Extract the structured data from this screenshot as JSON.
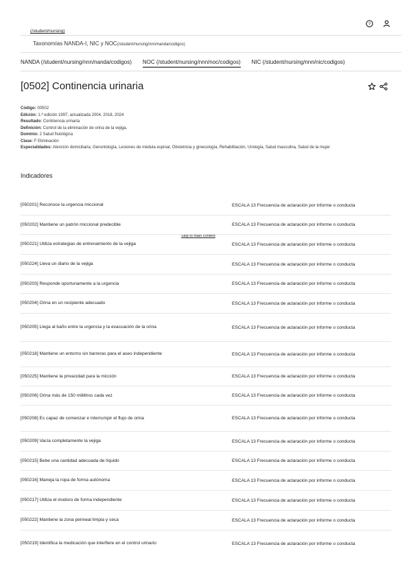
{
  "header": {
    "student_link": "(/student/nursing)",
    "help_icon": "help-circle-icon",
    "user_icon": "user-icon"
  },
  "breadcrumb": {
    "label": "Taxonomías NANDA-I, NIC y NOC",
    "path": "(/student/nursing/nnn/nanda/codigos)"
  },
  "tabs": [
    {
      "label": "NANDA (/student/nursing/nnn/nanda/codigos)",
      "active": false
    },
    {
      "label": "NOC (/student/nursing/nnn/noc/codigos)",
      "active": true
    },
    {
      "label": "NIC (/student/nursing/nnn/nic/codigos)",
      "active": false
    }
  ],
  "page": {
    "title": "[0502] Continencia urinaria",
    "star_icon": "star-outline-icon",
    "share_icon": "share-icon"
  },
  "meta": {
    "codigo": {
      "label": "Código:",
      "value": "00502"
    },
    "edicion": {
      "label": "Edición:",
      "value": "1.ª edición 1997; actualizada 2004, 2018, 2024"
    },
    "resultado": {
      "label": "Resultado:",
      "value": "Continencia urinaria"
    },
    "definicion": {
      "label": "Definición:",
      "value": "Control de la eliminación de orina de la vejiga."
    },
    "dominio": {
      "label": "Dominio:",
      "value": "2  Salud fisiológica"
    },
    "clase": {
      "label": "Clase:",
      "value": "F  Eliminación"
    },
    "especialidades": {
      "label": "Especialidades:",
      "value": "Atención domiciliaria, Gerontología, Lesiones de médula espinal, Obstetricia y ginecología, Rehabilitación, Urología, Salud masculina, Salud de la mujer"
    }
  },
  "indicators_title": "Indicadores",
  "skip_link": "Skip to main content",
  "indicators": [
    {
      "text": "[050201] Reconoce la urgencia miccional",
      "scale": "ESCALA 13 Frecuencia de aclaración por informe o conducta"
    },
    {
      "text": "[050202] Mantiene un patrón miccional predecible",
      "scale": "ESCALA 13 Frecuencia de aclaración por informe o conducta"
    },
    {
      "text": "[050221] Utiliza estrategias de entrenamiento de la vejiga",
      "scale": "ESCALA 13 Frecuencia de aclaración por informe o conducta"
    },
    {
      "text": "[050224] Lleva un diario de la vejiga",
      "scale": "ESCALA 13 Frecuencia de aclaración por informe o conducta"
    },
    {
      "text": "[050203] Responde oportunamente a la urgencia",
      "scale": "ESCALA 13 Frecuencia de aclaración por informe o conducta"
    },
    {
      "text": "[050204] Orina en un recipiente adecuado",
      "scale": "ESCALA 13 Frecuencia de aclaración por informe o conducta"
    },
    {
      "text": "[050205] Llega al baño entre la urgencia y la evacuación de la orina",
      "scale": "ESCALA 13 Frecuencia de aclaración por informe o conducta"
    },
    {
      "text": "[050218] Mantiene un entorno sin barreras para el aseo independiente",
      "scale": "ESCALA 13 Frecuencia de aclaración por informe o conducta"
    },
    {
      "text": "[050225] Mantiene la privacidad para la micción",
      "scale": "ESCALA 13 Frecuencia de aclaración por informe o conducta"
    },
    {
      "text": "[050206] Orina más de 150 mililitros cada vez",
      "scale": "ESCALA 13 Frecuencia de aclaración por informe o conducta"
    },
    {
      "text": "[050208] Es capaz de comenzar e interrumpir el flujo de orina",
      "scale": "ESCALA 13 Frecuencia de aclaración por informe o conducta"
    },
    {
      "text": "[050209] Vacía completamente la vejiga",
      "scale": "ESCALA 13 Frecuencia de aclaración por informe o conducta"
    },
    {
      "text": "[050215] Bebe una cantidad adecuada de líquido",
      "scale": "ESCALA 13 Frecuencia de aclaración por informe o conducta"
    },
    {
      "text": "[050216] Maneja la ropa de forma autónoma",
      "scale": "ESCALA 13 Frecuencia de aclaración por informe o conducta"
    },
    {
      "text": "[050217] Utiliza el inodoro de forma independiente",
      "scale": "ESCALA 13 Frecuencia de aclaración por informe o conducta"
    },
    {
      "text": "[050222] Mantiene la zona perineal limpia y seca",
      "scale": "ESCALA 13 Frecuencia de aclaración por informe o conducta"
    },
    {
      "text": "[050219] Identifica la medicación que interfiere en el control urinario",
      "scale": "ESCALA 13 Frecuencia de aclaración por informe o conducta"
    }
  ]
}
